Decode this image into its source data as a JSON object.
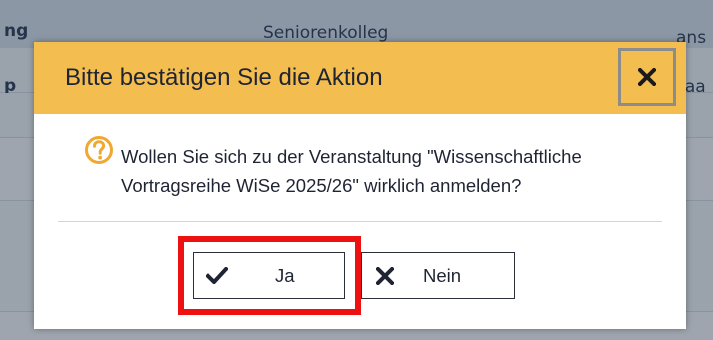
{
  "background": {
    "header_left": "ng",
    "header_center": "Seniorenkolleg",
    "row1_left": "p",
    "row1_right": "ans",
    "row2_right": "saa"
  },
  "dialog": {
    "title": "Bitte bestätigen Sie die Aktion",
    "close_icon": "close-x-icon",
    "question_icon": "question-circle-icon",
    "message": "Wollen Sie sich zu der Veranstaltung \"Wissenschaftliche Vortragsreihe WiSe 2025/26\" wirklich anmelden?",
    "buttons": {
      "yes_label": "Ja",
      "yes_icon": "checkmark-icon",
      "no_label": "Nein",
      "no_icon": "x-icon"
    }
  },
  "colors": {
    "titlebar": "#f3bd50",
    "question_icon": "#f0a830",
    "highlight": "#ee1111"
  }
}
